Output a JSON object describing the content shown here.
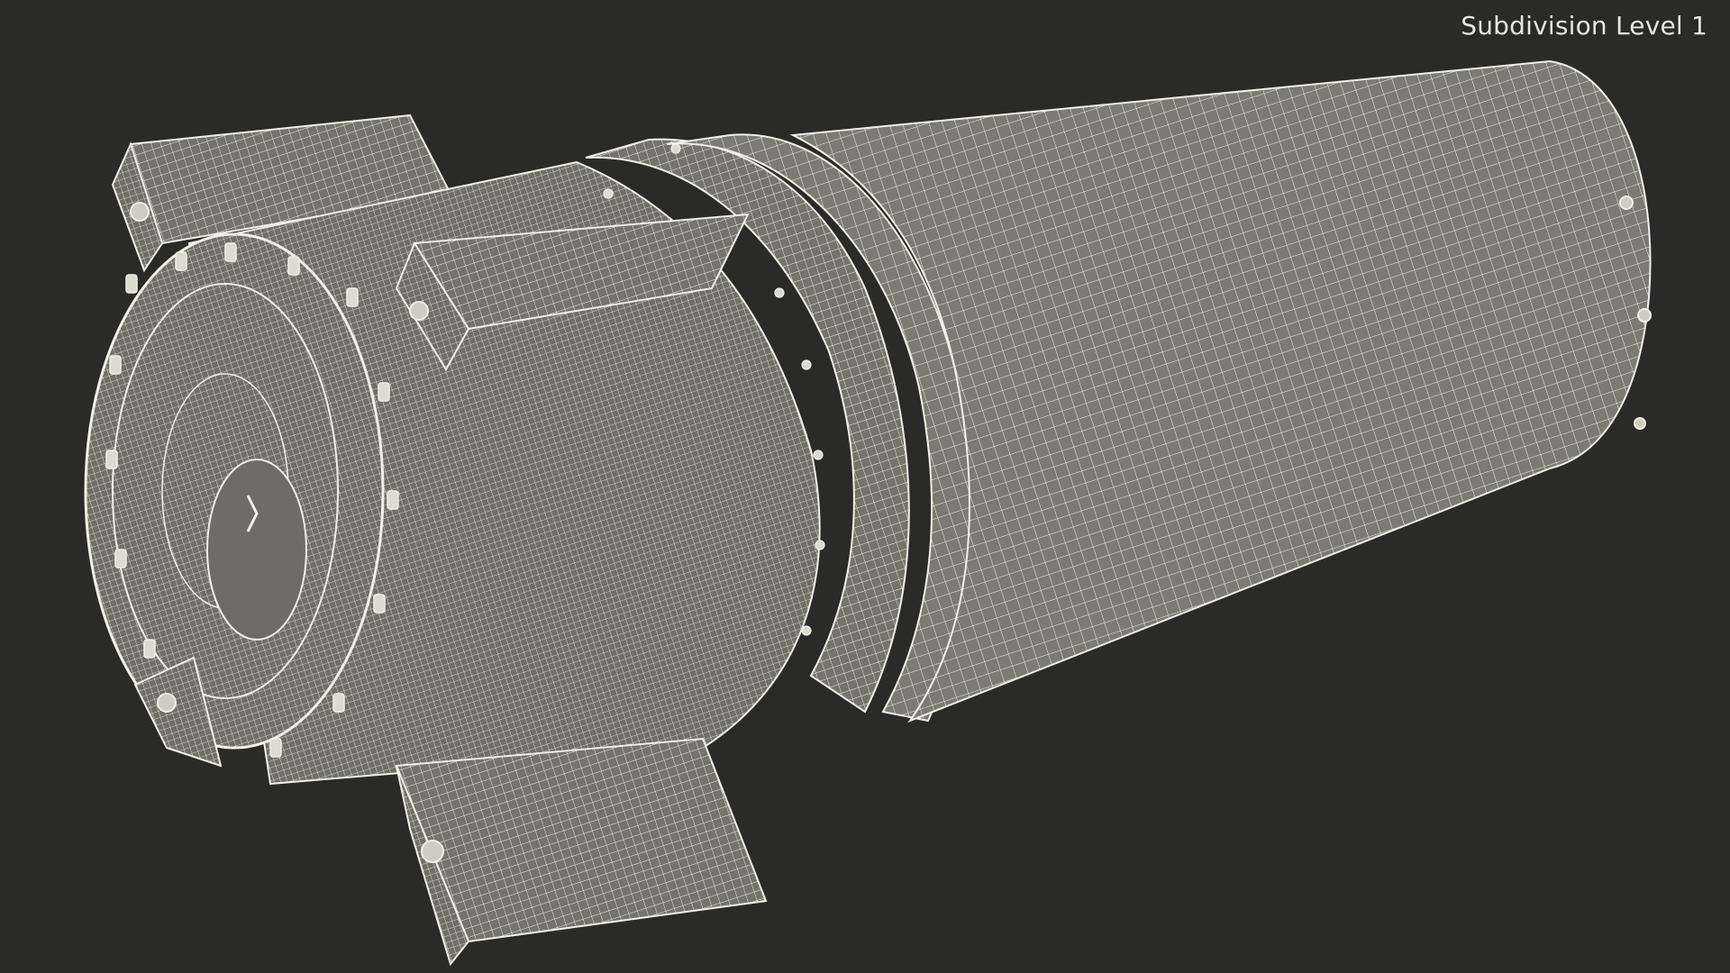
{
  "viewport": {
    "label": "Subdivision Level 1",
    "background": "#2a2a29",
    "mesh_fill": "#7b7b71",
    "wire_color": "#f2f0e6"
  }
}
